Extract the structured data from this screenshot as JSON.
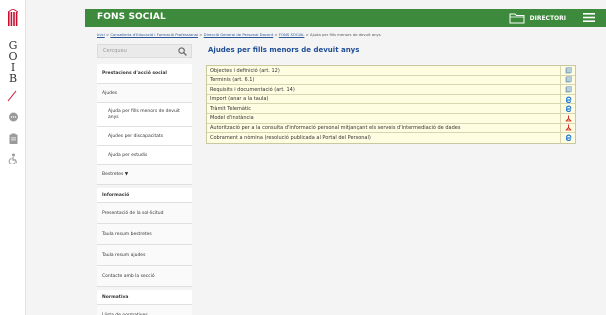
{
  "header": {
    "brand": "FONS SOCIAL",
    "directory_label": "DIRECTORI"
  },
  "rail": {
    "letters": [
      "G",
      "O",
      "I",
      "B"
    ]
  },
  "breadcrumb": {
    "items": [
      "Inici",
      "Conselleria d'Educació i Formació Professional",
      "Direcció General de Personal Docent",
      "FONS SOCIAL"
    ],
    "current": "Ajuda per fills menors de devuit anys"
  },
  "search": {
    "placeholder": "Cercqueu"
  },
  "sidebar": {
    "items": [
      {
        "label": "Prestacions d'acció social",
        "kind": "head"
      },
      {
        "label": "Ajudes",
        "kind": "plain"
      },
      {
        "label": "Ajuda per fills menors de devuit anys",
        "kind": "sub"
      },
      {
        "label": "Ajudes per discapacitats",
        "kind": "sub"
      },
      {
        "label": "Ajuda per estudis",
        "kind": "sub"
      },
      {
        "label": "Bestretes  ▼",
        "kind": "plain"
      },
      {
        "label": "Informació",
        "kind": "head"
      },
      {
        "label": "Presentació de la sol·licitud",
        "kind": "plain"
      },
      {
        "label": "Taula resum bestretes",
        "kind": "plain"
      },
      {
        "label": "Taula resum ajudes",
        "kind": "plain"
      },
      {
        "label": "Contacte amb la secció",
        "kind": "plain"
      },
      {
        "label": "Normativa",
        "kind": "head"
      },
      {
        "label": "Llista de normatives",
        "kind": "plain"
      }
    ]
  },
  "main": {
    "title": "Ajudes per fills menors de devuit anys",
    "rows": [
      {
        "label": "Objectes i definició (art. 12)",
        "icon": "document-icon"
      },
      {
        "label": "Terminis (art. 6.1)",
        "icon": "document-icon"
      },
      {
        "label": "Requisits i documentació (art. 14)",
        "icon": "document-icon"
      },
      {
        "label": "Import (anar a la taula)",
        "icon": "browser-icon"
      },
      {
        "label": "Tràmit Telemàtic",
        "icon": "browser-icon"
      },
      {
        "label": "Model d'instància",
        "icon": "pdf-icon"
      },
      {
        "label": "Autorització per a la consulta d'informació personal mitjançant els serveis d'intermediació de dades",
        "icon": "pdf-icon"
      },
      {
        "label": "Cobrament a nòmina (resolució publicada al Portal del Personal)",
        "icon": "browser-icon"
      }
    ]
  },
  "colors": {
    "header_green": "#3e8a3c",
    "title_blue": "#1f4e96",
    "table_yellow": "#fffde1",
    "goib_red": "#c8102e"
  }
}
